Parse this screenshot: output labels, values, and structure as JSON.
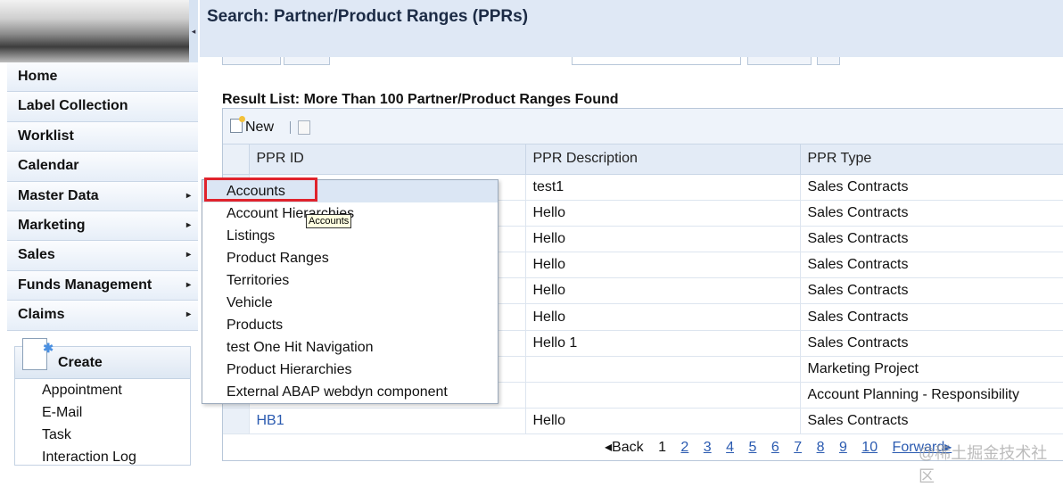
{
  "header": {
    "title": "Search: Partner/Product Ranges (PPRs)"
  },
  "nav": {
    "items": [
      {
        "label": "Home",
        "arrow": ""
      },
      {
        "label": "Label Collection",
        "arrow": ""
      },
      {
        "label": "Worklist",
        "arrow": ""
      },
      {
        "label": "Calendar",
        "arrow": ""
      },
      {
        "label": "Master Data",
        "arrow": "▸"
      },
      {
        "label": "Marketing",
        "arrow": "▸"
      },
      {
        "label": "Sales",
        "arrow": "▸"
      },
      {
        "label": "Funds Management",
        "arrow": "▸"
      },
      {
        "label": "Claims",
        "arrow": "▸"
      }
    ]
  },
  "create": {
    "title": "Create",
    "links": [
      "Appointment",
      "E-Mail",
      "Task",
      "Interaction Log"
    ]
  },
  "results": {
    "title": "Result List: More Than 100 Partner/Product Ranges Found",
    "new_label": "New",
    "columns": [
      "PPR ID",
      "PPR Description",
      "PPR Type"
    ],
    "rows": [
      {
        "id": "",
        "desc": "test1",
        "type": "Sales Contracts"
      },
      {
        "id": "",
        "desc": "Hello",
        "type": "Sales Contracts"
      },
      {
        "id": "",
        "desc": "Hello",
        "type": "Sales Contracts"
      },
      {
        "id": "",
        "desc": "Hello",
        "type": "Sales Contracts"
      },
      {
        "id": "",
        "desc": "Hello",
        "type": "Sales Contracts"
      },
      {
        "id": "",
        "desc": "Hello",
        "type": "Sales Contracts"
      },
      {
        "id": "",
        "desc": "Hello 1",
        "type": "Sales Contracts"
      },
      {
        "id": "",
        "desc": "",
        "type": "Marketing Project"
      },
      {
        "id": "",
        "desc": "",
        "type": "Account Planning - Responsibility"
      },
      {
        "id": "HB1",
        "desc": "Hello",
        "type": "Sales Contracts"
      }
    ]
  },
  "pager": {
    "back": "◂Back",
    "current": "1",
    "pages": [
      "2",
      "3",
      "4",
      "5",
      "6",
      "7",
      "8",
      "9",
      "10"
    ],
    "forward": "Forward▸"
  },
  "menu": {
    "items": [
      "Accounts",
      "Account Hierarchies",
      "Listings",
      "Product Ranges",
      "Territories",
      "Vehicle",
      "Products",
      "test One Hit Navigation",
      "Product Hierarchies",
      "External ABAP webdyn component"
    ],
    "hovered_index": 0,
    "tooltip": "Accounts"
  },
  "watermark": "@稀土掘金技术社区"
}
